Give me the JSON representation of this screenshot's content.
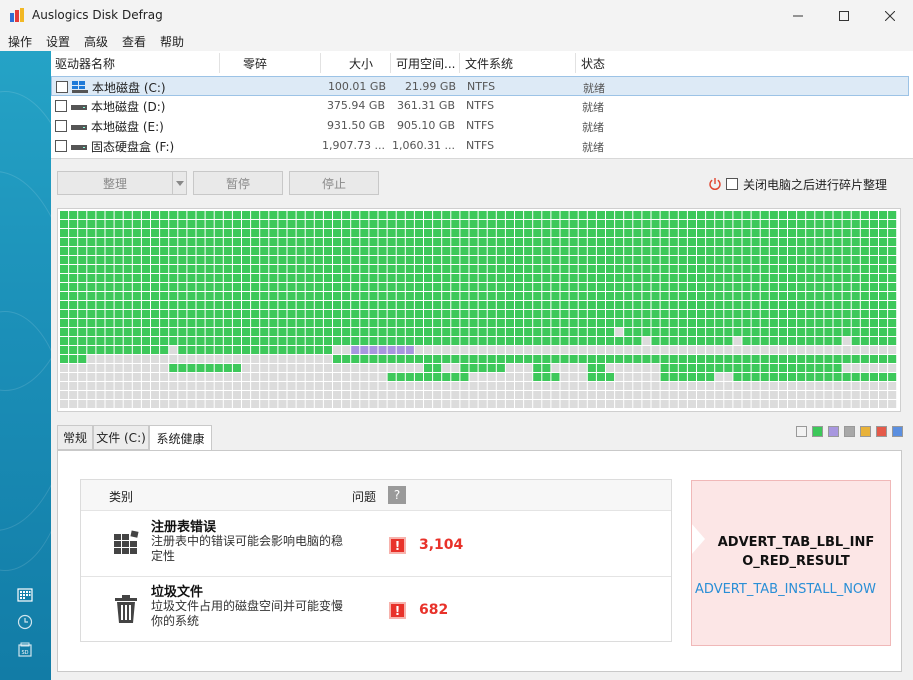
{
  "window": {
    "title": "Auslogics Disk Defrag"
  },
  "menu": [
    "操作",
    "设置",
    "高级",
    "查看",
    "帮助"
  ],
  "drive_list": {
    "columns": [
      "驱动器名称",
      "零碎",
      "大小",
      "可用空间...",
      "文件系统",
      "状态"
    ],
    "rows": [
      {
        "name": "本地磁盘 (C:)",
        "fragment": "",
        "size": "100.01 GB",
        "free": "21.99 GB",
        "fs": "NTFS",
        "status": "就绪",
        "checked": false,
        "selected": true,
        "icon": "windows-drive-icon"
      },
      {
        "name": "本地磁盘 (D:)",
        "fragment": "",
        "size": "375.94 GB",
        "free": "361.31 GB",
        "fs": "NTFS",
        "status": "就绪",
        "checked": false,
        "selected": false,
        "icon": "hard-drive-icon"
      },
      {
        "name": "本地磁盘 (E:)",
        "fragment": "",
        "size": "931.50 GB",
        "free": "905.10 GB",
        "fs": "NTFS",
        "status": "就绪",
        "checked": false,
        "selected": false,
        "icon": "hard-drive-icon"
      },
      {
        "name": "固态硬盘盒 (F:)",
        "fragment": "",
        "size": "1,907.73 ...",
        "free": "1,060.31 ...",
        "fs": "NTFS",
        "status": "就绪",
        "checked": false,
        "selected": false,
        "icon": "hard-drive-icon"
      }
    ]
  },
  "toolbar": {
    "defrag_label": "整理",
    "pause_label": "暂停",
    "stop_label": "停止",
    "shutdown_label": "关闭电脑之后进行碎片整理"
  },
  "cluster_map": {
    "columns": 92,
    "rows": 22,
    "colors": {
      "used": "#3dc85a",
      "free": "#dcdcdc",
      "system": "#a897df"
    },
    "free_cells": [
      [
        13,
        61
      ],
      [
        14,
        64
      ],
      [
        14,
        74
      ],
      [
        14,
        86
      ],
      [
        15,
        12
      ],
      [
        15,
        30
      ],
      [
        15,
        31
      ],
      [
        15,
        32
      ],
      [
        15,
        33
      ],
      [
        15,
        34
      ],
      [
        15,
        35
      ],
      [
        15,
        36
      ],
      [
        15,
        37
      ],
      [
        15,
        38
      ],
      [
        15,
        39
      ],
      [
        15,
        40
      ],
      [
        15,
        41
      ],
      [
        15,
        42
      ],
      [
        15,
        43
      ],
      [
        15,
        44
      ],
      [
        15,
        45
      ],
      [
        15,
        46
      ],
      [
        15,
        47
      ],
      [
        15,
        48
      ],
      [
        15,
        49
      ],
      [
        15,
        50
      ],
      [
        15,
        51
      ],
      [
        15,
        52
      ],
      [
        15,
        53
      ],
      [
        15,
        54
      ],
      [
        15,
        55
      ],
      [
        15,
        56
      ],
      [
        15,
        57
      ],
      [
        15,
        58
      ],
      [
        15,
        59
      ],
      [
        15,
        60
      ],
      [
        15,
        61
      ],
      [
        15,
        62
      ],
      [
        15,
        63
      ],
      [
        15,
        64
      ],
      [
        15,
        65
      ],
      [
        15,
        66
      ],
      [
        15,
        67
      ],
      [
        15,
        68
      ],
      [
        15,
        69
      ],
      [
        15,
        70
      ],
      [
        15,
        71
      ],
      [
        15,
        72
      ],
      [
        15,
        73
      ],
      [
        15,
        74
      ],
      [
        15,
        75
      ],
      [
        15,
        76
      ],
      [
        15,
        77
      ],
      [
        15,
        78
      ],
      [
        15,
        79
      ],
      [
        15,
        80
      ],
      [
        15,
        81
      ],
      [
        15,
        82
      ],
      [
        15,
        83
      ],
      [
        15,
        84
      ],
      [
        15,
        85
      ],
      [
        15,
        86
      ],
      [
        15,
        87
      ],
      [
        15,
        88
      ],
      [
        15,
        89
      ],
      [
        15,
        90
      ],
      [
        15,
        91
      ]
    ],
    "system_cells": [
      [
        15,
        32
      ],
      [
        15,
        33
      ],
      [
        15,
        34
      ],
      [
        15,
        35
      ],
      [
        15,
        36
      ],
      [
        15,
        37
      ],
      [
        15,
        38
      ]
    ]
  },
  "tabs": [
    {
      "label": "常规",
      "active": false
    },
    {
      "label": "文件 (C:)",
      "active": false
    },
    {
      "label": "系统健康",
      "active": true
    }
  ],
  "legend_colors": [
    "#f2f2f2",
    "#3dc85a",
    "#a897df",
    "#a8a8a8",
    "#e8b23a",
    "#e45a4a",
    "#5b8fe0"
  ],
  "health": {
    "header_category": "类别",
    "header_problems": "问题",
    "help_icon_label": "?",
    "items": [
      {
        "title": "注册表错误",
        "description": "注册表中的错误可能会影响电脑的稳定性",
        "count": "3,104",
        "icon": "registry-icon"
      },
      {
        "title": "垃圾文件",
        "description": "垃圾文件占用的磁盘空间并可能变慢你的系统",
        "count": "682",
        "icon": "trash-icon"
      }
    ]
  },
  "advert": {
    "title": "ADVERT_TAB_LBL_INFO_RED_RESULT",
    "link": "ADVERT_TAB_INSTALL_NOW"
  }
}
